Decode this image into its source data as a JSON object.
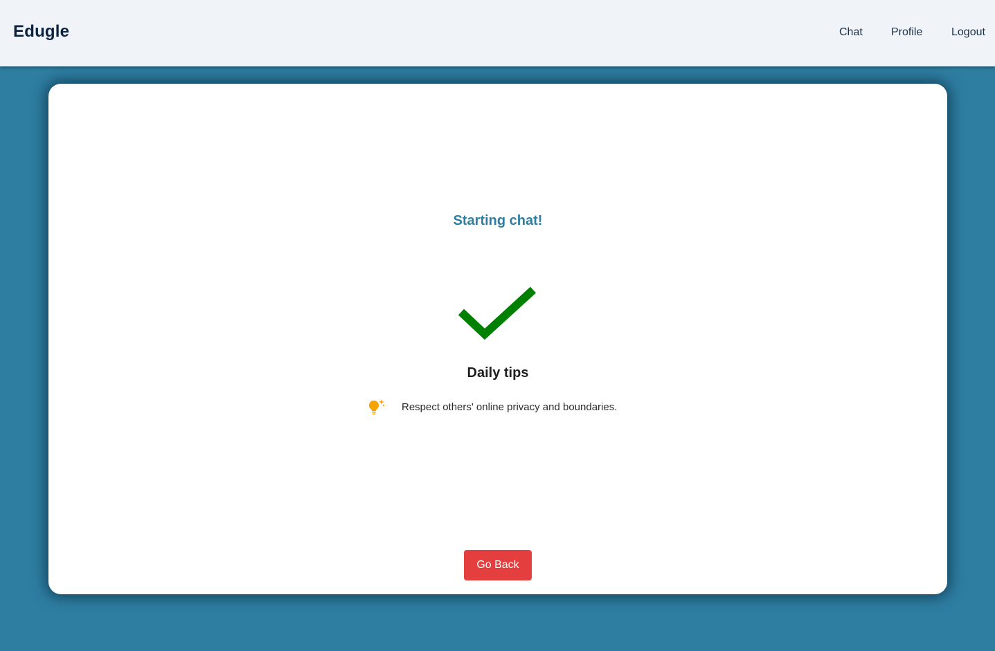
{
  "header": {
    "brand": "Edugle",
    "nav": {
      "chat": "Chat",
      "profile": "Profile",
      "logout": "Logout"
    }
  },
  "main": {
    "status_title": "Starting chat!",
    "status_icon": "checkmark-icon",
    "tips_title": "Daily tips",
    "tip": {
      "icon": "lightbulb-icon",
      "text": "Respect others' online privacy and boundaries."
    },
    "go_back_label": "Go Back"
  },
  "colors": {
    "page_background": "#2e7ea2",
    "header_background": "#f0f4f9",
    "brand_text": "#0c2340",
    "status_title": "#2e7ea2",
    "checkmark": "#008000",
    "lightbulb": "#f5a300",
    "go_back_button": "#e53e3e"
  }
}
